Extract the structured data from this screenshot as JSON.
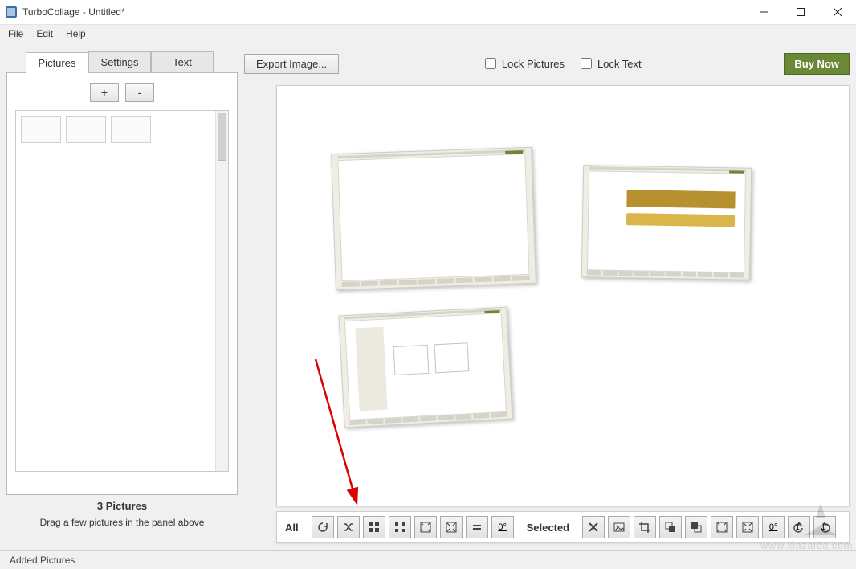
{
  "window": {
    "title": "TurboCollage - Untitled*"
  },
  "menu": {
    "items": [
      "File",
      "Edit",
      "Help"
    ]
  },
  "sidebar": {
    "tabs": [
      "Pictures",
      "Settings",
      "Text"
    ],
    "active_tab": 0,
    "add_label": "+",
    "remove_label": "-",
    "thumb_count": 3,
    "count_label": "3 Pictures",
    "hint": "Drag a few pictures in the panel above"
  },
  "topbar": {
    "export_label": "Export Image...",
    "lock_pictures_label": "Lock Pictures",
    "lock_text_label": "Lock Text",
    "lock_pictures_checked": false,
    "lock_text_checked": false,
    "buy_now_label": "Buy Now"
  },
  "bottombar": {
    "all_label": "All",
    "selected_label": "Selected",
    "all_tools": [
      "refresh-icon",
      "shuffle-icon",
      "grid-fill-icon",
      "grid-gap-icon",
      "fit-icon",
      "expand-icon",
      "equal-icon",
      "zero-deg-icon"
    ],
    "selected_tools": [
      "delete-icon",
      "image-icon",
      "crop-icon",
      "send-back-icon",
      "bring-front-icon",
      "fit-sel-icon",
      "expand-sel-icon",
      "zero-deg-sel-icon",
      "rotate-ccw-icon",
      "rotate-cw-icon"
    ],
    "zero_deg_text": "0°",
    "one_deg_ccw": "1°",
    "one_deg_cw": "1°"
  },
  "status": {
    "text": "Added Pictures"
  },
  "watermark": {
    "text": "www.xiazaiba.com"
  }
}
